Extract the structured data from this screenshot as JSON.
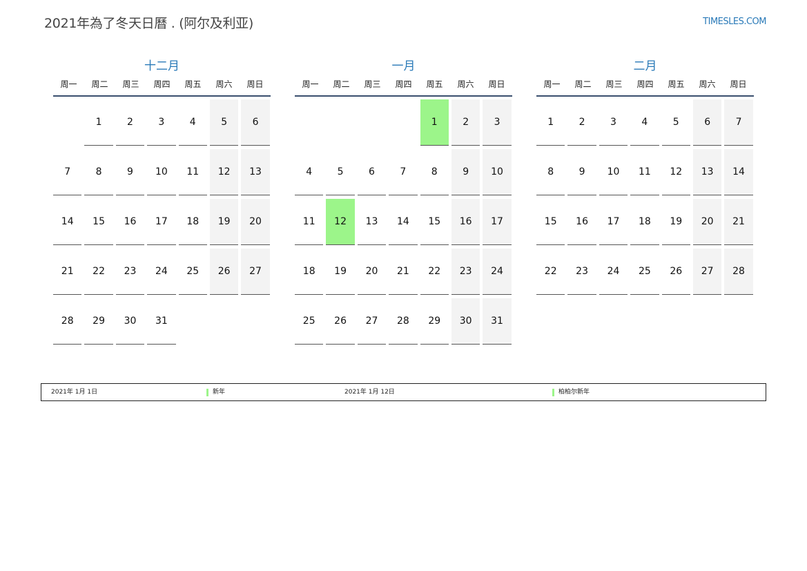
{
  "header": {
    "title": "2021年為了冬天日曆 . (阿尔及利亚)",
    "site": "TIMESLES.COM"
  },
  "weekday_labels": [
    "周一",
    "周二",
    "周三",
    "周四",
    "周五",
    "周六",
    "周日"
  ],
  "months": [
    {
      "name": "十二月",
      "offset": 1,
      "days": 31,
      "holidays": []
    },
    {
      "name": "一月",
      "offset": 4,
      "days": 31,
      "holidays": [
        1,
        12
      ]
    },
    {
      "name": "二月",
      "offset": 0,
      "days": 28,
      "holidays": []
    }
  ],
  "legend": [
    {
      "date": "2021年 1月 1日",
      "name": "新年",
      "color": "#9cf58a"
    },
    {
      "date": "2021年 1月 12日",
      "name": "柏柏尔新年",
      "color": "#9cf58a"
    }
  ]
}
